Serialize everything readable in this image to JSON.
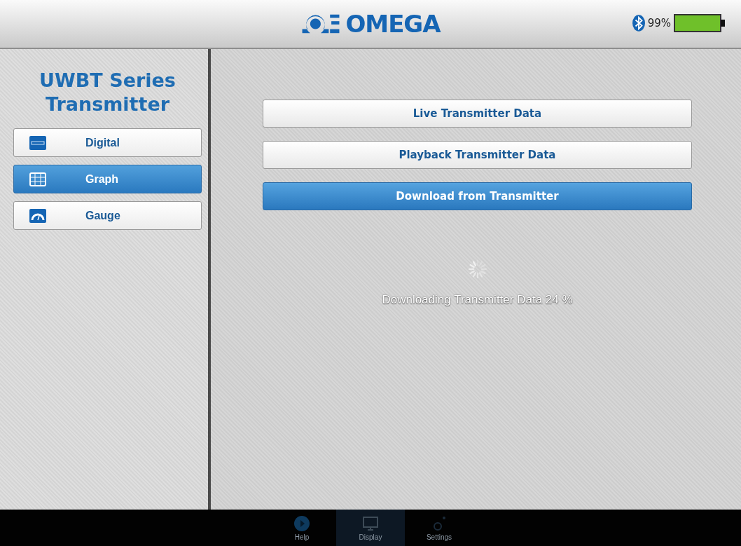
{
  "header": {
    "logo": "OMEGA",
    "battery_text": "99%"
  },
  "sidebar": {
    "title": "UWBT Series Transmitter",
    "items": [
      {
        "label": "Digital",
        "kind": "digital",
        "selected": false
      },
      {
        "label": "Graph",
        "kind": "graph",
        "selected": true
      },
      {
        "label": "Gauge",
        "kind": "gauge",
        "selected": false
      }
    ]
  },
  "actions": [
    {
      "label": "Live Transmitter Data",
      "selected": false
    },
    {
      "label": "Playback Transmitter Data",
      "selected": false
    },
    {
      "label": "Download from Transmitter",
      "selected": true
    }
  ],
  "status": "Downloading Transmitter Data 24 %",
  "tab_bar": [
    {
      "label": "Help",
      "kind": "help",
      "selected": false
    },
    {
      "label": "Display",
      "kind": "display",
      "selected": true
    },
    {
      "label": "Settings",
      "kind": "settings",
      "selected": false
    }
  ]
}
